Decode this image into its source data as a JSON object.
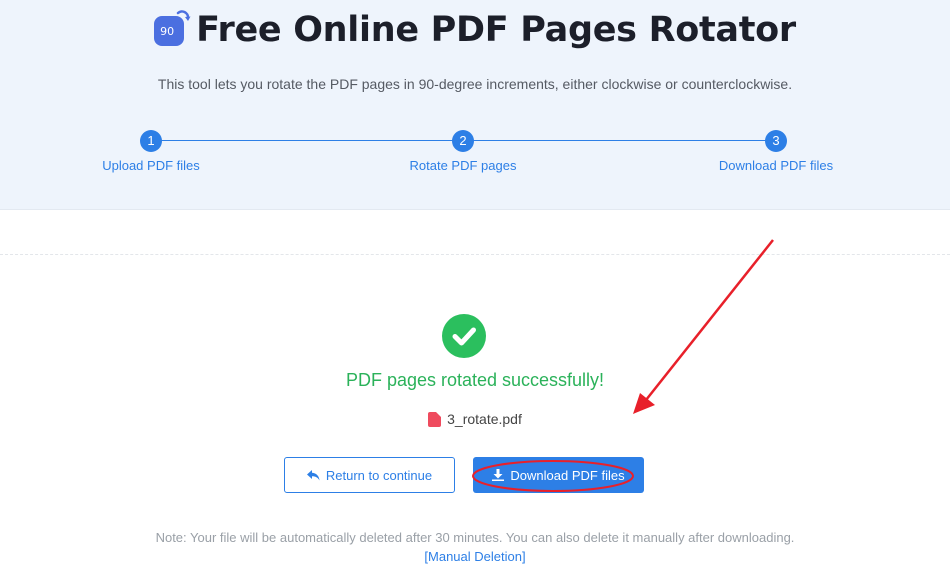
{
  "header": {
    "logo_text": "90",
    "title": "Free Online PDF Pages Rotator",
    "subtitle": "This tool lets you rotate the PDF pages in 90-degree increments, either clockwise or counterclockwise."
  },
  "steps": [
    {
      "number": "1",
      "label": "Upload PDF files"
    },
    {
      "number": "2",
      "label": "Rotate PDF pages"
    },
    {
      "number": "3",
      "label": "Download PDF files"
    }
  ],
  "result": {
    "success_message": "PDF pages rotated successfully!",
    "file_name": "3_rotate.pdf"
  },
  "actions": {
    "return_label": "Return to continue",
    "download_label": "Download PDF files"
  },
  "footer": {
    "note": "Note: Your file will be automatically deleted after 30 minutes. You can also delete it manually after downloading.",
    "manual_deletion": "[Manual Deletion]"
  },
  "colors": {
    "accent": "#2d7fe6",
    "success": "#2bb25a",
    "annotation": "#e8202a"
  },
  "icons": {
    "logo": "rotate-90-icon",
    "check": "check-circle-icon",
    "file": "pdf-file-icon",
    "return": "reply-arrow-icon",
    "download": "download-icon"
  }
}
